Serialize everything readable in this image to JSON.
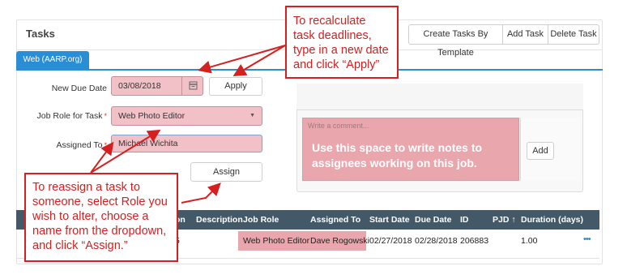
{
  "panel": {
    "title": "Tasks"
  },
  "toolbar": {
    "create_by_template": "Create Tasks By Template",
    "add_task": "Add Task",
    "delete_task": "Delete Task"
  },
  "tab": {
    "label": "Web (AARP.org)"
  },
  "form": {
    "new_due_date_label": "New Due Date",
    "new_due_date_value": "03/08/2018",
    "apply": "Apply",
    "job_role_label": "Job Role for Task",
    "job_role_value": "Web Photo Editor",
    "assigned_to_label": "Assigned To",
    "assigned_to_value": "Michael Wichita",
    "assign": "Assign",
    "required_mark": "*"
  },
  "comment": {
    "placeholder": "Write a comment...",
    "add": "Add",
    "note": "Use this space to write notes to assignees working on this job."
  },
  "table": {
    "columns": [
      "on",
      "Description",
      "Job Role",
      "Assigned To",
      "Start Date",
      "Due Date",
      "ID",
      "PJD ↑",
      "Duration (days)"
    ],
    "row": {
      "partial": "5",
      "job_role": "Web Photo Editor",
      "assigned_to": "Dave Rogowski",
      "start_date": "02/27/2018",
      "due_date": "02/28/2018",
      "id": "206883",
      "duration": "1.00",
      "menu": "•••"
    }
  },
  "callouts": {
    "top_right": "To recalculate task deadlines, type in a new date and click “Apply”",
    "bottom_left": "To reassign a task to someone, select Role you wish to alter, choose a name from the dropdown, and click “Assign.”"
  },
  "icons": {
    "calendar": "calendar-icon",
    "dropdown": "chevron-down-icon",
    "row_menu": "more-icon"
  },
  "colors": {
    "accent": "#2a8ed7",
    "callout": "#d62020",
    "highlight": "#e9a7ad",
    "table_header": "#435967"
  }
}
